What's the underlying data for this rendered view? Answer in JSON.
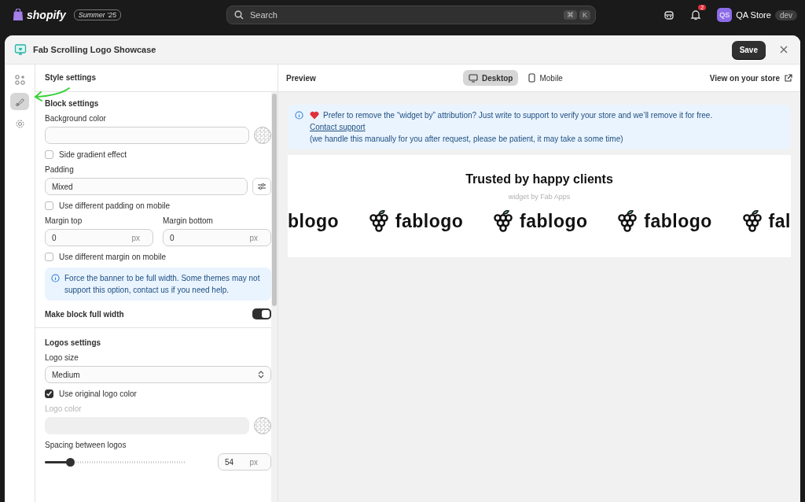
{
  "topbar": {
    "brand": "shopify",
    "edition": "Summer '25",
    "search": {
      "placeholder": "Search",
      "keys": [
        "⌘",
        "K"
      ]
    },
    "notifications": "2",
    "store": {
      "initials": "QS",
      "name": "QA Store",
      "badge": "dev"
    }
  },
  "window": {
    "title": "Fab Scrolling Logo Showcase",
    "save": "Save"
  },
  "rail": [
    {
      "selected": false
    },
    {
      "selected": true
    },
    {
      "selected": false
    }
  ],
  "settings": {
    "title": "Style settings",
    "sections": [
      {
        "title": "Block settings",
        "items": [
          {
            "kind": "color",
            "label": "Background color",
            "disabled": false
          },
          {
            "kind": "checkbox",
            "label": "Side gradient effect",
            "checked": false
          },
          {
            "kind": "select-button",
            "label": "Padding",
            "value": "Mixed"
          },
          {
            "kind": "checkbox",
            "label": "Use different padding on mobile",
            "checked": false
          },
          {
            "kind": "pair",
            "fields": [
              {
                "label": "Margin top",
                "value": "0",
                "unit": "px"
              },
              {
                "label": "Margin bottom",
                "value": "0",
                "unit": "px"
              }
            ]
          },
          {
            "kind": "checkbox",
            "label": "Use different margin on mobile",
            "checked": false
          },
          {
            "kind": "info",
            "text": "Force the banner to be full width. Some themes may not support this option, contact us if you need help."
          },
          {
            "kind": "toggle",
            "label": "Make block full width",
            "on": true
          }
        ]
      },
      {
        "title": "Logos settings",
        "items": [
          {
            "kind": "select",
            "label": "Logo size",
            "value": "Medium"
          },
          {
            "kind": "checkbox",
            "label": "Use original logo color",
            "checked": true
          },
          {
            "kind": "color",
            "label": "Logo color",
            "disabled": true
          },
          {
            "kind": "slider",
            "label": "Spacing between logos",
            "level": 0.18,
            "value": "54",
            "unit": "px"
          }
        ]
      }
    ]
  },
  "preview": {
    "title": "Preview",
    "tabs": [
      {
        "label": "Desktop",
        "selected": true
      },
      {
        "label": "Mobile",
        "selected": false
      }
    ],
    "view_link": "View on your store",
    "notice": {
      "text": "Prefer to remove the “widget by” attribution? Just write to support to verify your store and we’ll remove it for free.",
      "link": "Contact support",
      "note": "(we handle this manually for you after request, please be patient, it may take a some time)"
    },
    "widget": {
      "heading": "Trusted by happy clients",
      "credit": "widget by Fab Apps",
      "logos": [
        "blogo",
        "fablogo",
        "fablogo",
        "fablogo",
        "fal"
      ]
    }
  }
}
